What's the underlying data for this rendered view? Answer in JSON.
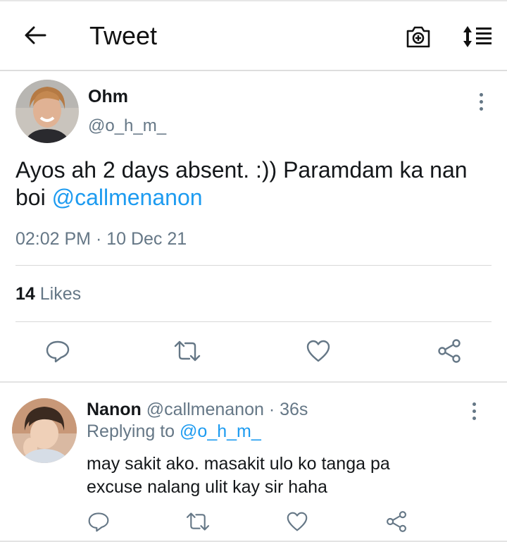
{
  "header": {
    "title": "Tweet",
    "icons": [
      "back-arrow-icon",
      "camera-add-icon",
      "sort-icon"
    ]
  },
  "tweet": {
    "author_name": "Ohm",
    "author_handle": "@o_h_m_",
    "text_before": "Ayos ah 2 days absent. :)) Paramdam ka nan boi ",
    "mention": "@callmenanon",
    "timestamp": "02:02 PM · 10 Dec 21",
    "likes_count": "14",
    "likes_label": "Likes"
  },
  "reply": {
    "author_name": "Nanon",
    "author_handle": "@callmenanon",
    "time": "· 36s",
    "replying_label": "Replying to",
    "replying_handle": "@o_h_m_",
    "text_line1": "may sakit ako. masakit ulo ko tanga pa",
    "text_line2": "excuse nalang ulit kay sir haha"
  },
  "colors": {
    "accent": "#1d9bf0",
    "secondary_text": "#657786",
    "icon": "#657786"
  }
}
